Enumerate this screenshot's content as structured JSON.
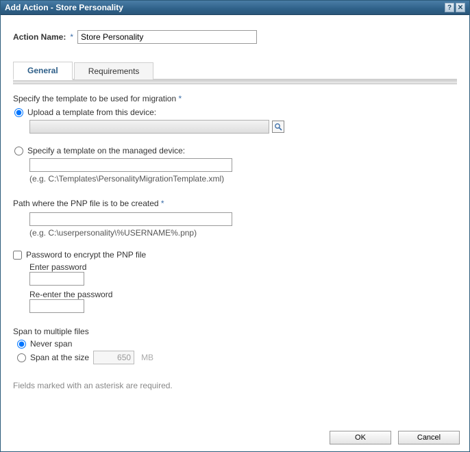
{
  "window": {
    "title": "Add Action - Store Personality",
    "help_icon": "?",
    "close_icon": "✕"
  },
  "actionName": {
    "label": "Action Name:",
    "required": "*",
    "value": "Store Personality"
  },
  "tabs": {
    "general": "General",
    "requirements": "Requirements"
  },
  "template": {
    "heading": "Specify the template to be used for migration",
    "required": "*",
    "upload": {
      "label": "Upload a template from this device:",
      "value": "",
      "browse_icon": "search"
    },
    "specify": {
      "label": "Specify a template on the managed device:",
      "value": "",
      "hint": "(e.g. C:\\Templates\\PersonalityMigrationTemplate.xml)"
    }
  },
  "pnpPath": {
    "heading": "Path where the PNP file is to be created",
    "required": "*",
    "value": "",
    "hint": "(e.g. C:\\userpersonality\\%USERNAME%.pnp)"
  },
  "password": {
    "label": "Password to encrypt the PNP file",
    "checked": false,
    "enter_label": "Enter password",
    "reenter_label": "Re-enter the password",
    "value1": "",
    "value2": ""
  },
  "span": {
    "heading": "Span to multiple files",
    "never": "Never span",
    "at_size": "Span at the size",
    "size_value": "650",
    "size_unit": "MB"
  },
  "footerNote": "Fields marked with an asterisk are required.",
  "buttons": {
    "ok": "OK",
    "cancel": "Cancel"
  }
}
